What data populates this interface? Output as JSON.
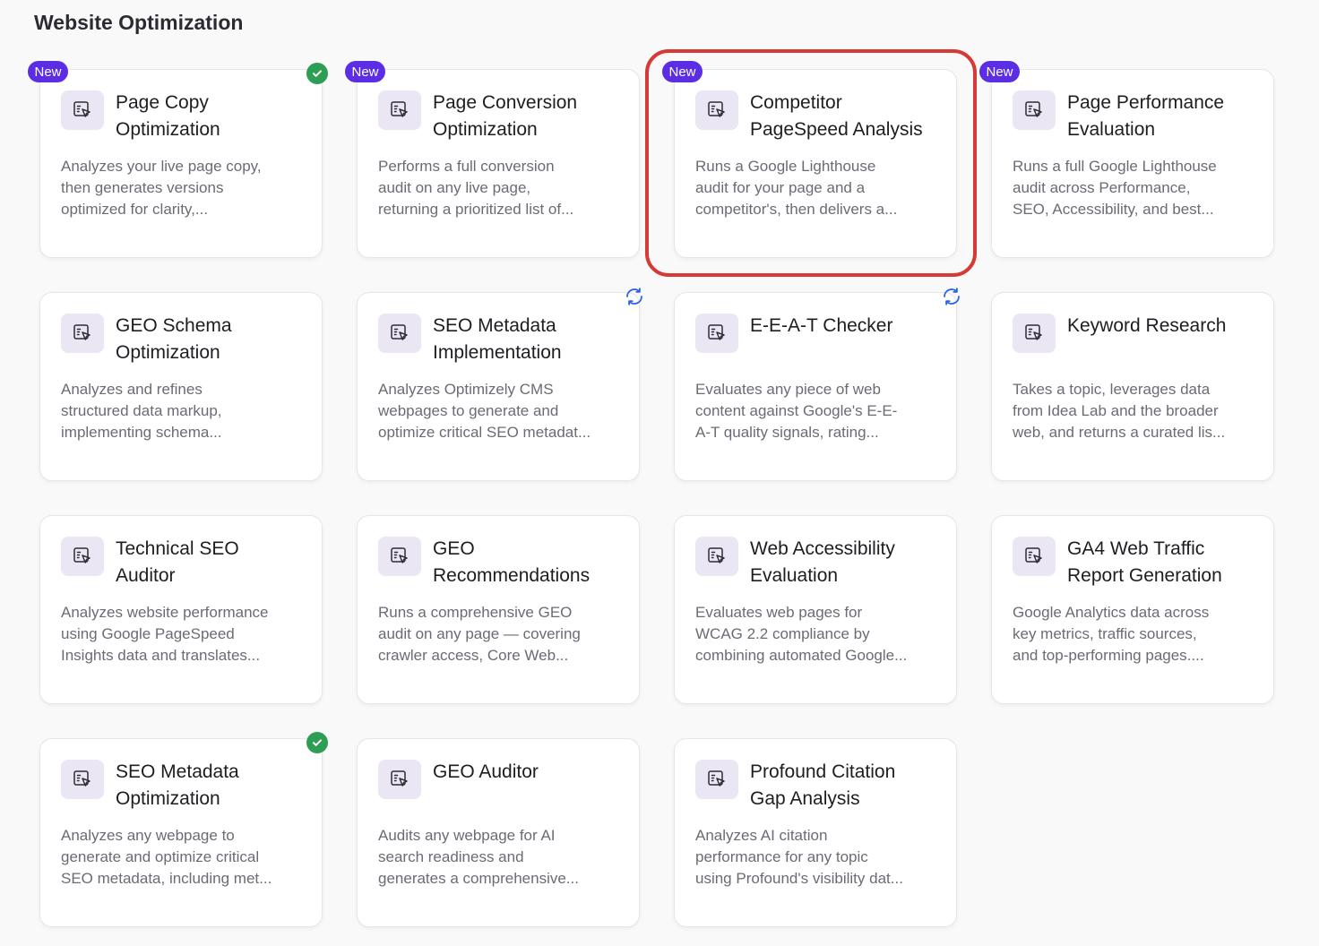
{
  "section": {
    "title": "Website Optimization"
  },
  "badge_label": "New",
  "colors": {
    "accent": "#5b2ee6",
    "success": "#2f9e55",
    "sync": "#2563eb",
    "highlight": "#d53a34"
  },
  "cards": [
    {
      "title_lines": [
        "Page Copy",
        "Optimization"
      ],
      "desc_lines": [
        "Analyzes your live page copy,",
        "then generates versions",
        "optimized for clarity,..."
      ],
      "icon": "pointer-edit-icon",
      "badge": "New",
      "status": "check"
    },
    {
      "title_lines": [
        "Page Conversion",
        "Optimization"
      ],
      "desc_lines": [
        "Performs a full conversion",
        "audit on any live page,",
        "returning a prioritized list of..."
      ],
      "icon": "pointer-edit-icon",
      "badge": "New",
      "status": ""
    },
    {
      "title_lines": [
        "Competitor",
        "PageSpeed Analysis"
      ],
      "desc_lines": [
        "Runs a Google Lighthouse",
        "audit for your page and a",
        "competitor's, then delivers a..."
      ],
      "icon": "pointer-edit-icon",
      "badge": "New",
      "status": "",
      "highlighted": true
    },
    {
      "title_lines": [
        "Page Performance",
        "Evaluation"
      ],
      "desc_lines": [
        "Runs a full Google Lighthouse",
        "audit across Performance,",
        "SEO, Accessibility, and best..."
      ],
      "icon": "pointer-edit-icon",
      "badge": "New",
      "status": ""
    },
    {
      "title_lines": [
        "GEO Schema",
        "Optimization"
      ],
      "desc_lines": [
        "Analyzes and refines",
        "structured data markup,",
        "implementing schema..."
      ],
      "icon": "pointer-edit-icon",
      "badge": "",
      "status": ""
    },
    {
      "title_lines": [
        "SEO Metadata",
        "Implementation"
      ],
      "desc_lines": [
        "Analyzes Optimizely CMS",
        "webpages to generate and",
        "optimize critical SEO metadat..."
      ],
      "icon": "pointer-edit-icon",
      "badge": "",
      "status": "sync"
    },
    {
      "title_lines": [
        "E-E-A-T Checker"
      ],
      "desc_lines": [
        "Evaluates any piece of web",
        "content against Google's E-E-",
        "A-T quality signals, rating..."
      ],
      "icon": "pointer-edit-icon",
      "badge": "",
      "status": "sync"
    },
    {
      "title_lines": [
        "Keyword Research"
      ],
      "desc_lines": [
        "Takes a topic, leverages data",
        "from Idea Lab and the broader",
        "web, and returns a curated lis..."
      ],
      "icon": "pointer-edit-icon",
      "badge": "",
      "status": ""
    },
    {
      "title_lines": [
        "Technical SEO",
        "Auditor"
      ],
      "desc_lines": [
        "Analyzes website performance",
        "using Google PageSpeed",
        "Insights data and translates..."
      ],
      "icon": "pointer-edit-icon",
      "badge": "",
      "status": ""
    },
    {
      "title_lines": [
        "GEO",
        "Recommendations"
      ],
      "desc_lines": [
        "Runs a comprehensive GEO",
        "audit on any page — covering",
        "crawler access, Core Web..."
      ],
      "icon": "pointer-edit-icon",
      "badge": "",
      "status": ""
    },
    {
      "title_lines": [
        "Web Accessibility",
        "Evaluation"
      ],
      "desc_lines": [
        "Evaluates web pages for",
        "WCAG 2.2 compliance by",
        "combining automated Google..."
      ],
      "icon": "pointer-edit-icon",
      "badge": "",
      "status": ""
    },
    {
      "title_lines": [
        "GA4 Web Traffic",
        "Report Generation"
      ],
      "desc_lines": [
        "Google Analytics data across",
        "key metrics, traffic sources,",
        "and top-performing pages...."
      ],
      "icon": "pointer-edit-icon",
      "badge": "",
      "status": ""
    },
    {
      "title_lines": [
        "SEO Metadata",
        "Optimization"
      ],
      "desc_lines": [
        "Analyzes any webpage to",
        "generate and optimize critical",
        "SEO metadata, including met..."
      ],
      "icon": "pointer-edit-icon",
      "badge": "",
      "status": "check"
    },
    {
      "title_lines": [
        "GEO Auditor"
      ],
      "desc_lines": [
        "Audits any webpage for AI",
        "search readiness and",
        "generates a comprehensive..."
      ],
      "icon": "pointer-edit-icon",
      "badge": "",
      "status": ""
    },
    {
      "title_lines": [
        "Profound Citation",
        "Gap Analysis"
      ],
      "desc_lines": [
        "Analyzes AI citation",
        "performance for any topic",
        "using Profound's visibility dat..."
      ],
      "icon": "pointer-edit-icon",
      "badge": "",
      "status": ""
    }
  ]
}
